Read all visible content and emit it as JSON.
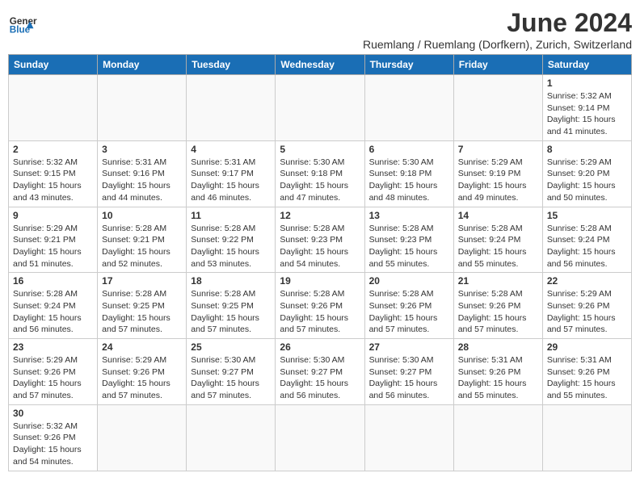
{
  "header": {
    "logo_general": "General",
    "logo_blue": "Blue",
    "month_title": "June 2024",
    "subtitle": "Ruemlang / Ruemlang (Dorfkern), Zurich, Switzerland"
  },
  "days_of_week": [
    "Sunday",
    "Monday",
    "Tuesday",
    "Wednesday",
    "Thursday",
    "Friday",
    "Saturday"
  ],
  "weeks": [
    [
      {
        "day": "",
        "info": ""
      },
      {
        "day": "",
        "info": ""
      },
      {
        "day": "",
        "info": ""
      },
      {
        "day": "",
        "info": ""
      },
      {
        "day": "",
        "info": ""
      },
      {
        "day": "",
        "info": ""
      },
      {
        "day": "1",
        "info": "Sunrise: 5:32 AM\nSunset: 9:14 PM\nDaylight: 15 hours\nand 41 minutes."
      }
    ],
    [
      {
        "day": "2",
        "info": "Sunrise: 5:32 AM\nSunset: 9:15 PM\nDaylight: 15 hours\nand 43 minutes."
      },
      {
        "day": "3",
        "info": "Sunrise: 5:31 AM\nSunset: 9:16 PM\nDaylight: 15 hours\nand 44 minutes."
      },
      {
        "day": "4",
        "info": "Sunrise: 5:31 AM\nSunset: 9:17 PM\nDaylight: 15 hours\nand 46 minutes."
      },
      {
        "day": "5",
        "info": "Sunrise: 5:30 AM\nSunset: 9:18 PM\nDaylight: 15 hours\nand 47 minutes."
      },
      {
        "day": "6",
        "info": "Sunrise: 5:30 AM\nSunset: 9:18 PM\nDaylight: 15 hours\nand 48 minutes."
      },
      {
        "day": "7",
        "info": "Sunrise: 5:29 AM\nSunset: 9:19 PM\nDaylight: 15 hours\nand 49 minutes."
      },
      {
        "day": "8",
        "info": "Sunrise: 5:29 AM\nSunset: 9:20 PM\nDaylight: 15 hours\nand 50 minutes."
      }
    ],
    [
      {
        "day": "9",
        "info": "Sunrise: 5:29 AM\nSunset: 9:21 PM\nDaylight: 15 hours\nand 51 minutes."
      },
      {
        "day": "10",
        "info": "Sunrise: 5:28 AM\nSunset: 9:21 PM\nDaylight: 15 hours\nand 52 minutes."
      },
      {
        "day": "11",
        "info": "Sunrise: 5:28 AM\nSunset: 9:22 PM\nDaylight: 15 hours\nand 53 minutes."
      },
      {
        "day": "12",
        "info": "Sunrise: 5:28 AM\nSunset: 9:23 PM\nDaylight: 15 hours\nand 54 minutes."
      },
      {
        "day": "13",
        "info": "Sunrise: 5:28 AM\nSunset: 9:23 PM\nDaylight: 15 hours\nand 55 minutes."
      },
      {
        "day": "14",
        "info": "Sunrise: 5:28 AM\nSunset: 9:24 PM\nDaylight: 15 hours\nand 55 minutes."
      },
      {
        "day": "15",
        "info": "Sunrise: 5:28 AM\nSunset: 9:24 PM\nDaylight: 15 hours\nand 56 minutes."
      }
    ],
    [
      {
        "day": "16",
        "info": "Sunrise: 5:28 AM\nSunset: 9:24 PM\nDaylight: 15 hours\nand 56 minutes."
      },
      {
        "day": "17",
        "info": "Sunrise: 5:28 AM\nSunset: 9:25 PM\nDaylight: 15 hours\nand 57 minutes."
      },
      {
        "day": "18",
        "info": "Sunrise: 5:28 AM\nSunset: 9:25 PM\nDaylight: 15 hours\nand 57 minutes."
      },
      {
        "day": "19",
        "info": "Sunrise: 5:28 AM\nSunset: 9:26 PM\nDaylight: 15 hours\nand 57 minutes."
      },
      {
        "day": "20",
        "info": "Sunrise: 5:28 AM\nSunset: 9:26 PM\nDaylight: 15 hours\nand 57 minutes."
      },
      {
        "day": "21",
        "info": "Sunrise: 5:28 AM\nSunset: 9:26 PM\nDaylight: 15 hours\nand 57 minutes."
      },
      {
        "day": "22",
        "info": "Sunrise: 5:29 AM\nSunset: 9:26 PM\nDaylight: 15 hours\nand 57 minutes."
      }
    ],
    [
      {
        "day": "23",
        "info": "Sunrise: 5:29 AM\nSunset: 9:26 PM\nDaylight: 15 hours\nand 57 minutes."
      },
      {
        "day": "24",
        "info": "Sunrise: 5:29 AM\nSunset: 9:26 PM\nDaylight: 15 hours\nand 57 minutes."
      },
      {
        "day": "25",
        "info": "Sunrise: 5:30 AM\nSunset: 9:27 PM\nDaylight: 15 hours\nand 57 minutes."
      },
      {
        "day": "26",
        "info": "Sunrise: 5:30 AM\nSunset: 9:27 PM\nDaylight: 15 hours\nand 56 minutes."
      },
      {
        "day": "27",
        "info": "Sunrise: 5:30 AM\nSunset: 9:27 PM\nDaylight: 15 hours\nand 56 minutes."
      },
      {
        "day": "28",
        "info": "Sunrise: 5:31 AM\nSunset: 9:26 PM\nDaylight: 15 hours\nand 55 minutes."
      },
      {
        "day": "29",
        "info": "Sunrise: 5:31 AM\nSunset: 9:26 PM\nDaylight: 15 hours\nand 55 minutes."
      }
    ],
    [
      {
        "day": "30",
        "info": "Sunrise: 5:32 AM\nSunset: 9:26 PM\nDaylight: 15 hours\nand 54 minutes."
      },
      {
        "day": "",
        "info": ""
      },
      {
        "day": "",
        "info": ""
      },
      {
        "day": "",
        "info": ""
      },
      {
        "day": "",
        "info": ""
      },
      {
        "day": "",
        "info": ""
      },
      {
        "day": "",
        "info": ""
      }
    ]
  ]
}
